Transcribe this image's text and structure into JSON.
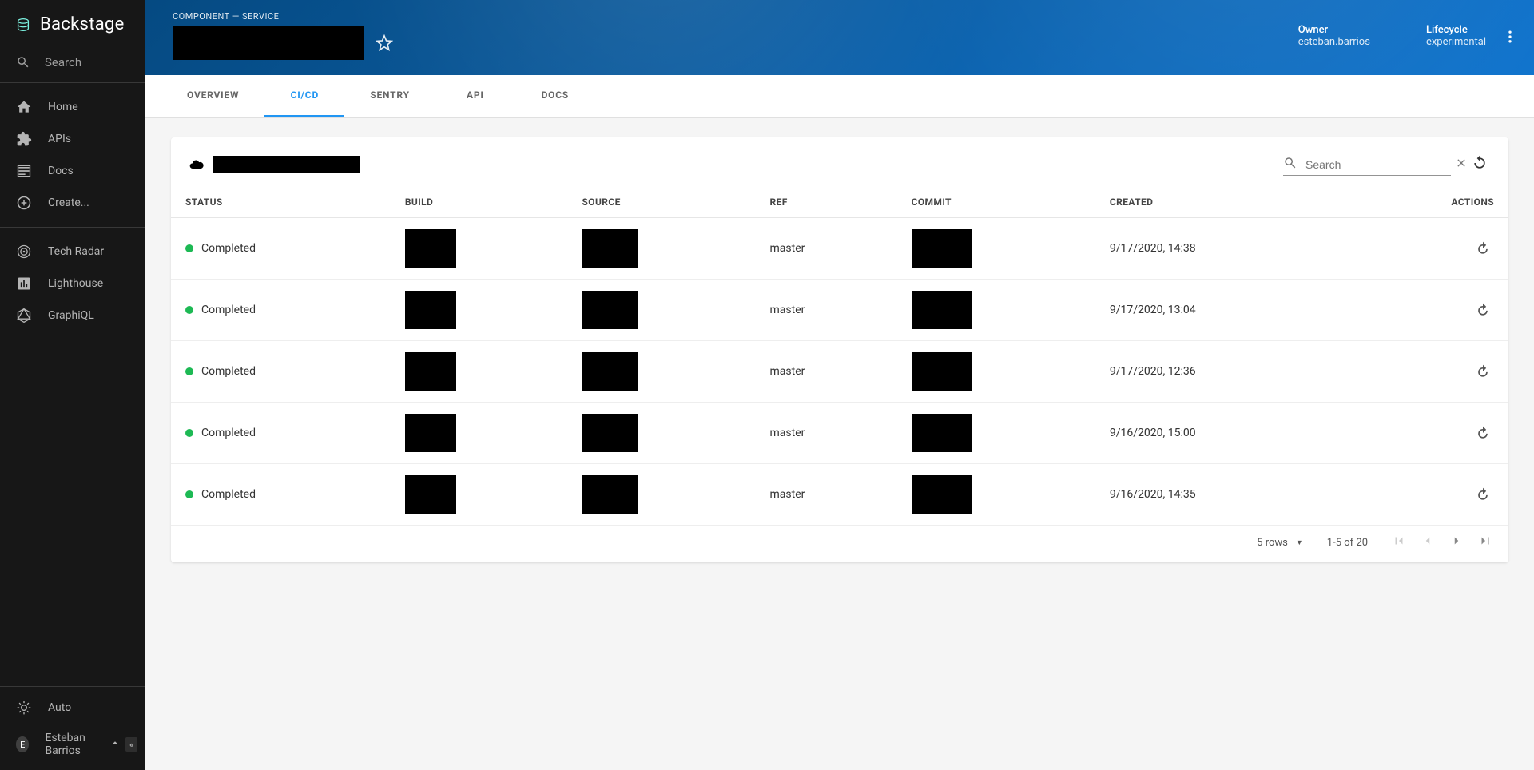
{
  "brand": {
    "name": "Backstage"
  },
  "search_placeholder": "Search",
  "sidebar": {
    "group1": [
      {
        "label": "Home",
        "name": "home"
      },
      {
        "label": "APIs",
        "name": "apis"
      },
      {
        "label": "Docs",
        "name": "docs"
      },
      {
        "label": "Create...",
        "name": "create"
      }
    ],
    "group2": [
      {
        "label": "Tech Radar",
        "name": "tech-radar"
      },
      {
        "label": "Lighthouse",
        "name": "lighthouse"
      },
      {
        "label": "GraphiQL",
        "name": "graphiql"
      }
    ],
    "footer": {
      "auto_label": "Auto",
      "user_initial": "E",
      "user_name": "Esteban Barrios",
      "collapse_symbol": "«"
    }
  },
  "hero": {
    "breadcrumb": "COMPONENT — SERVICE",
    "meta": [
      {
        "k": "Owner",
        "v": "esteban.barrios"
      },
      {
        "k": "Lifecycle",
        "v": "experimental"
      }
    ]
  },
  "tabs": [
    {
      "label": "OVERVIEW",
      "active": false
    },
    {
      "label": "CI/CD",
      "active": true
    },
    {
      "label": "SENTRY",
      "active": false
    },
    {
      "label": "API",
      "active": false
    },
    {
      "label": "DOCS",
      "active": false
    }
  ],
  "table": {
    "search_placeholder": "Search",
    "columns": [
      "STATUS",
      "BUILD",
      "SOURCE",
      "REF",
      "COMMIT",
      "CREATED",
      "ACTIONS"
    ],
    "rows": [
      {
        "status": "Completed",
        "ref": "master",
        "created": "9/17/2020, 14:38"
      },
      {
        "status": "Completed",
        "ref": "master",
        "created": "9/17/2020, 13:04"
      },
      {
        "status": "Completed",
        "ref": "master",
        "created": "9/17/2020, 12:36"
      },
      {
        "status": "Completed",
        "ref": "master",
        "created": "9/16/2020, 15:00"
      },
      {
        "status": "Completed",
        "ref": "master",
        "created": "9/16/2020, 14:35"
      }
    ],
    "footer": {
      "rows_label": "5 rows",
      "range": "1-5 of 20"
    }
  }
}
